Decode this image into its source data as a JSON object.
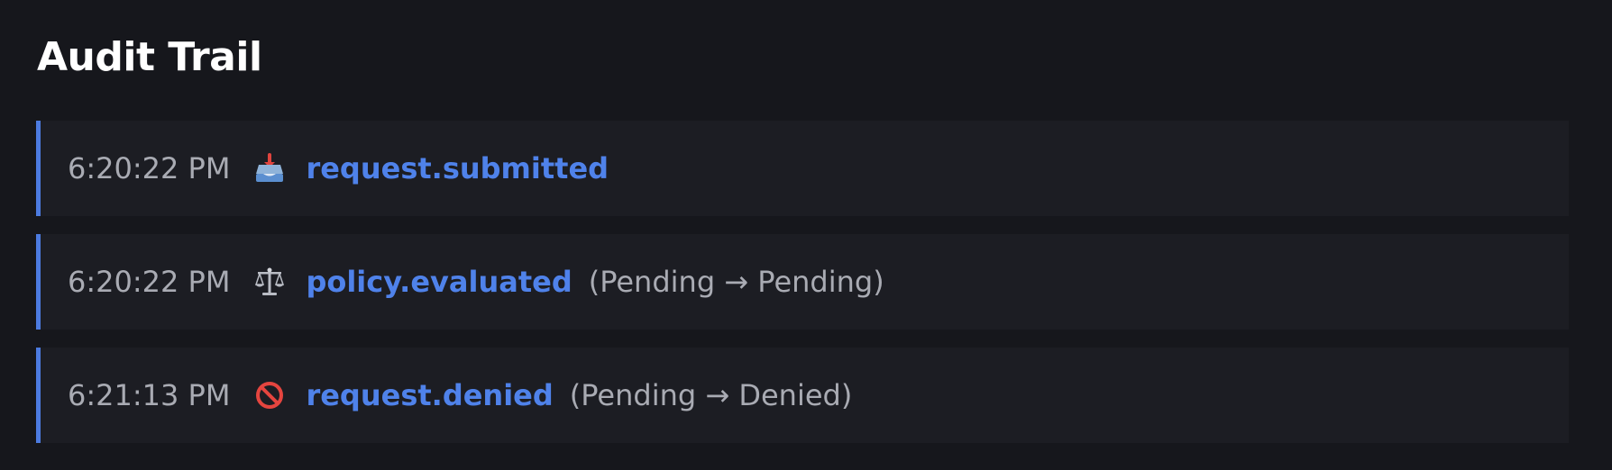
{
  "page": {
    "title": "Audit Trail"
  },
  "colors": {
    "background": "#16171c",
    "row_background": "#1c1d23",
    "accent": "#4c7be0",
    "event_text": "#4f82ea",
    "muted_text": "#a9abb3"
  },
  "entries": [
    {
      "time": "6:20:22 PM",
      "icon": "inbox-tray-icon",
      "event": "request.submitted",
      "transition": ""
    },
    {
      "time": "6:20:22 PM",
      "icon": "balance-scale-icon",
      "event": "policy.evaluated",
      "transition": "(Pending → Pending)"
    },
    {
      "time": "6:21:13 PM",
      "icon": "prohibited-icon",
      "event": "request.denied",
      "transition": "(Pending → Denied)"
    }
  ]
}
